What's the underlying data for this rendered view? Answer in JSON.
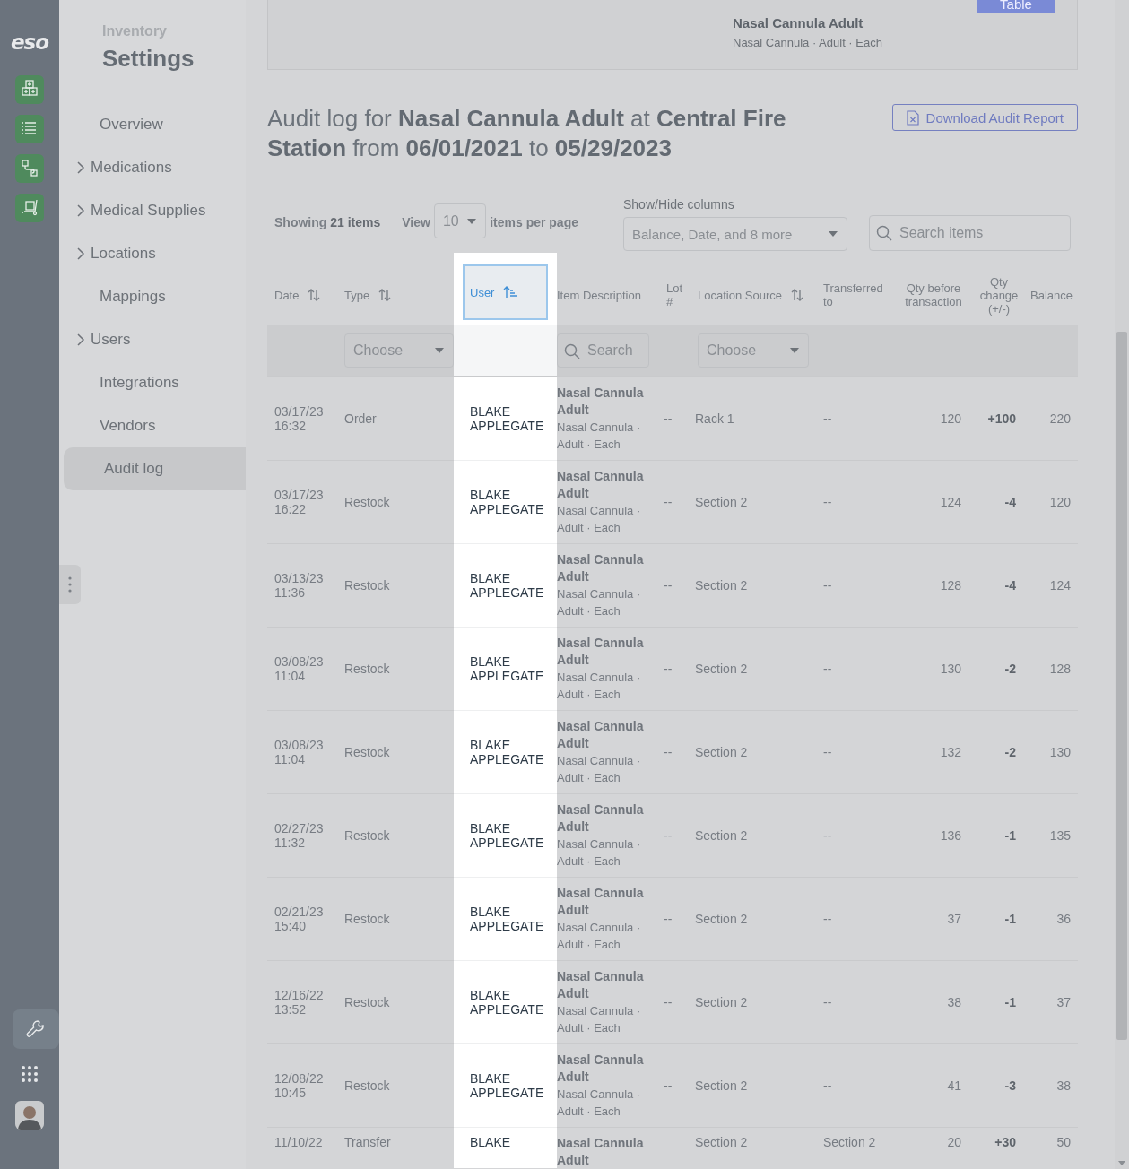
{
  "rail": {
    "logo": "eso",
    "tool_selected": true
  },
  "settings_nav": {
    "eyebrow": "Inventory",
    "title": "Settings",
    "items": [
      {
        "label": "Overview",
        "expandable": false,
        "selected": false
      },
      {
        "label": "Medications",
        "expandable": true,
        "selected": false
      },
      {
        "label": "Medical Supplies",
        "expandable": true,
        "selected": false
      },
      {
        "label": "Locations",
        "expandable": true,
        "selected": false
      },
      {
        "label": "Mappings",
        "expandable": false,
        "selected": false
      },
      {
        "label": "Users",
        "expandable": true,
        "selected": false
      },
      {
        "label": "Integrations",
        "expandable": false,
        "selected": false
      },
      {
        "label": "Vendors",
        "expandable": false,
        "selected": false
      },
      {
        "label": "Audit log",
        "expandable": false,
        "selected": true
      }
    ]
  },
  "item_card": {
    "name": "Nasal Cannula Adult",
    "detail": "Nasal Cannula · Adult · Each",
    "button": "Table"
  },
  "heading": "Audit log for **Nasal Cannula Adult** at **Central Fire Station** from **06/01/2021** to **05/29/2023**",
  "download_button": "Download Audit Report",
  "showing": "Showing **21 items**",
  "view_label": "View",
  "per_page": "10",
  "per_page_label": "items per page",
  "column_picker": {
    "label": "Show/Hide columns",
    "value": "Balance, Date, and 8 more"
  },
  "search": {
    "placeholder": "Search items"
  },
  "columns": [
    {
      "label": "Date",
      "sortable": true,
      "sorted": false,
      "highlighted": false
    },
    {
      "label": "Type",
      "sortable": true,
      "sorted": false,
      "highlighted": false,
      "filter": {
        "kind": "select",
        "placeholder": "Choose"
      }
    },
    {
      "label": "User",
      "sortable": true,
      "sorted": true,
      "highlighted": true
    },
    {
      "label": "Item Description",
      "highlighted": false,
      "filter": {
        "kind": "search",
        "placeholder": "Search"
      }
    },
    {
      "label": "Lot #",
      "highlighted": false
    },
    {
      "label": "Location Source",
      "sortable": true,
      "sorted": false,
      "highlighted": false,
      "filter": {
        "kind": "select",
        "placeholder": "Choose"
      }
    },
    {
      "label": "Transferred to",
      "highlighted": false
    },
    {
      "label": "Qty before transaction",
      "highlighted": false
    },
    {
      "label": "Qty change (+/-)",
      "highlighted": false
    },
    {
      "label": "Balance",
      "highlighted": false
    }
  ],
  "rows": [
    {
      "date": "03/17/23 16:32",
      "type": "Order",
      "user": "BLAKE APPLEGATE",
      "item_name": "Nasal Cannula Adult",
      "item_detail": "Nasal Cannula · Adult · Each",
      "lot": "--",
      "location": "Rack 1",
      "transferred": "--",
      "qty_before": "120",
      "qty_change": "+100",
      "balance": "220"
    },
    {
      "date": "03/17/23 16:22",
      "type": "Restock",
      "user": "BLAKE APPLEGATE",
      "item_name": "Nasal Cannula Adult",
      "item_detail": "Nasal Cannula · Adult · Each",
      "lot": "--",
      "location": "Section 2",
      "transferred": "--",
      "qty_before": "124",
      "qty_change": "-4",
      "balance": "120"
    },
    {
      "date": "03/13/23 11:36",
      "type": "Restock",
      "user": "BLAKE APPLEGATE",
      "item_name": "Nasal Cannula Adult",
      "item_detail": "Nasal Cannula · Adult · Each",
      "lot": "--",
      "location": "Section 2",
      "transferred": "--",
      "qty_before": "128",
      "qty_change": "-4",
      "balance": "124"
    },
    {
      "date": "03/08/23 11:04",
      "type": "Restock",
      "user": "BLAKE APPLEGATE",
      "item_name": "Nasal Cannula Adult",
      "item_detail": "Nasal Cannula · Adult · Each",
      "lot": "--",
      "location": "Section 2",
      "transferred": "--",
      "qty_before": "130",
      "qty_change": "-2",
      "balance": "128"
    },
    {
      "date": "03/08/23 11:04",
      "type": "Restock",
      "user": "BLAKE APPLEGATE",
      "item_name": "Nasal Cannula Adult",
      "item_detail": "Nasal Cannula · Adult · Each",
      "lot": "--",
      "location": "Section 2",
      "transferred": "--",
      "qty_before": "132",
      "qty_change": "-2",
      "balance": "130"
    },
    {
      "date": "02/27/23 11:32",
      "type": "Restock",
      "user": "BLAKE APPLEGATE",
      "item_name": "Nasal Cannula Adult",
      "item_detail": "Nasal Cannula · Adult · Each",
      "lot": "--",
      "location": "Section 2",
      "transferred": "--",
      "qty_before": "136",
      "qty_change": "-1",
      "balance": "135"
    },
    {
      "date": "02/21/23 15:40",
      "type": "Restock",
      "user": "BLAKE APPLEGATE",
      "item_name": "Nasal Cannula Adult",
      "item_detail": "Nasal Cannula · Adult · Each",
      "lot": "--",
      "location": "Section 2",
      "transferred": "--",
      "qty_before": "37",
      "qty_change": "-1",
      "balance": "36"
    },
    {
      "date": "12/16/22 13:52",
      "type": "Restock",
      "user": "BLAKE APPLEGATE",
      "item_name": "Nasal Cannula Adult",
      "item_detail": "Nasal Cannula · Adult · Each",
      "lot": "--",
      "location": "Section 2",
      "transferred": "--",
      "qty_before": "38",
      "qty_change": "-1",
      "balance": "37"
    },
    {
      "date": "12/08/22 10:45",
      "type": "Restock",
      "user": "BLAKE APPLEGATE",
      "item_name": "Nasal Cannula Adult",
      "item_detail": "Nasal Cannula · Adult · Each",
      "lot": "--",
      "location": "Section 2",
      "transferred": "--",
      "qty_before": "41",
      "qty_change": "-3",
      "balance": "38"
    },
    {
      "date": "11/10/22",
      "type": "Transfer",
      "user": "BLAKE",
      "item_name": "Nasal Cannula Adult",
      "location": "Section 2",
      "transferred": "Section 2",
      "qty_before": "20",
      "qty_change": "+30",
      "balance": "50"
    }
  ]
}
